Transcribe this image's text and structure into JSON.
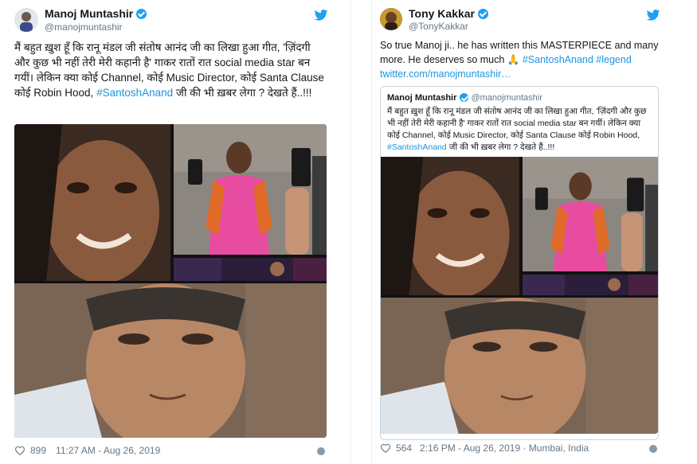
{
  "left_tweet": {
    "author_name": "Manoj Muntashir",
    "author_handle": "@manojmuntashir",
    "text_main": "मैं बहुत ख़ुश हूँ कि रानू मंडल जी संतोष आनंद जी का लिखा हुआ गीत, 'ज़िंदगी और कुछ भी नहीं तेरी मेरी कहानी है' गाकर रातों रात social media star बन गयीं। लेकिन क्या कोई Channel, कोई Music Director, कोई Santa Clause कोई Robin Hood,",
    "hashtag": "#SantoshAnand",
    "text_tail": "जी की भी ख़बर लेगा ? देखते हैं..!!!",
    "likes": "899",
    "timestamp": "11:27 AM - Aug 26, 2019"
  },
  "right_tweet": {
    "author_name": "Tony Kakkar",
    "author_handle": "@TonyKakkar",
    "text_main": "So true Manoj ji.. he has written this  MASTERPIECE and many more. He deserves so much 🙏",
    "hashtags": "#SantoshAnand #legend",
    "link": "twitter.com/manojmuntashir…",
    "quoted": {
      "author_name": "Manoj Muntashir",
      "author_handle": "@manojmuntashir",
      "text_main": "मैं बहुत ख़ुश हूँ कि रानू मंडल जी संतोष आनंद जी का लिखा हुआ गीत, 'ज़िंदगी और कुछ भी नहीं तेरी मेरी कहानी है' गाकर रातों रात social media star बन गयीं। लेकिन क्या कोई Channel, कोई Music Director, कोई Santa Clause कोई Robin Hood,",
      "hashtag": "#SantoshAnand",
      "text_tail": "जी की भी ख़बर लेगा ? देखते हैं..!!!"
    },
    "likes": "564",
    "timestamp": "2:16 PM - Aug 26, 2019 · Mumbai, India"
  },
  "colors": {
    "twitter_blue": "#1da1f2",
    "link_blue": "#1b95e0",
    "muted_gray": "#657786",
    "border_gray": "#ccd6dd"
  },
  "icons": [
    "twitter-bird-icon",
    "verified-badge-icon",
    "heart-icon",
    "info-icon"
  ]
}
